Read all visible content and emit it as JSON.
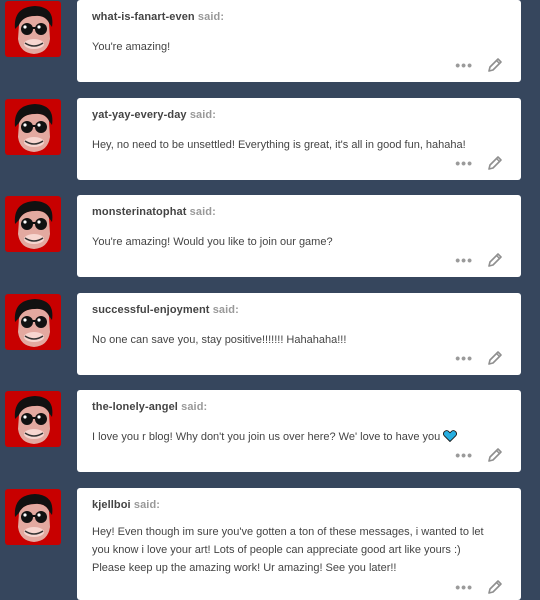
{
  "said_label": "said:",
  "posts": [
    {
      "sender": "what-is-fanart-even",
      "lines": [
        "You're amazing!"
      ]
    },
    {
      "sender": "yat-yay-every-day",
      "lines": [
        "Hey, no need to be unsettled! Everything is great, it's all in good fun, hahaha!"
      ]
    },
    {
      "sender": "monsterinatophat",
      "lines": [
        "You're amazing! Would you like to join our game?"
      ]
    },
    {
      "sender": "successful-enjoyment",
      "lines": [
        "No one can save you, stay positive!!!!!!! Hahahaha!!!"
      ]
    },
    {
      "sender": "the-lonely-angel",
      "lines": [
        "I love you r blog! Why don't you join us over here? We' love to have you"
      ]
    },
    {
      "sender": "kjellboi",
      "lines": [
        "Hey! Even though im sure you've gotten a ton of these messages, i wanted to let",
        "you know i love your art! Lots of people can appreciate good art like yours :)",
        "Please keep up the amazing work! Ur amazing! See you later!!"
      ]
    }
  ],
  "icons": {
    "more": "more-options-icon",
    "edit": "pencil-icon",
    "heart": "blue-heart-icon",
    "avatar": "masked-face-avatar"
  },
  "colors": {
    "background": "#36465d",
    "card": "#ffffff",
    "avatar_bg": "#c80000",
    "heart": "#27aee0"
  }
}
